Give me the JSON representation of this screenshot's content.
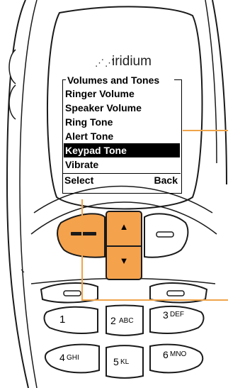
{
  "brand": {
    "logo_glyph": "⋰⋰",
    "name": "iridium"
  },
  "menu": {
    "title": "Volumes and Tones",
    "items": [
      {
        "label": "Ringer Volume",
        "selected": false
      },
      {
        "label": "Speaker Volume",
        "selected": false
      },
      {
        "label": "Ring Tone",
        "selected": false
      },
      {
        "label": "Alert Tone",
        "selected": false
      },
      {
        "label": "Keypad Tone",
        "selected": true
      },
      {
        "label": "Vibrate",
        "selected": false
      }
    ]
  },
  "softkeys": {
    "left": "Select",
    "right": "Back"
  },
  "keypad": [
    {
      "digit": "1",
      "letters": ""
    },
    {
      "digit": "2",
      "letters": "ABC"
    },
    {
      "digit": "3",
      "letters": "DEF"
    },
    {
      "digit": "4",
      "letters": "GHI"
    },
    {
      "digit": "5",
      "letters": "KL"
    },
    {
      "digit": "6",
      "letters": "MNO"
    }
  ],
  "nav": {
    "up_symbol": "▲",
    "down_symbol": "▼"
  },
  "colors": {
    "accent": "#f5a24c",
    "callout": "#f0a44a",
    "highlight": "#000000",
    "phone_body": "#ffffff",
    "outline": "#1a1a1a"
  }
}
